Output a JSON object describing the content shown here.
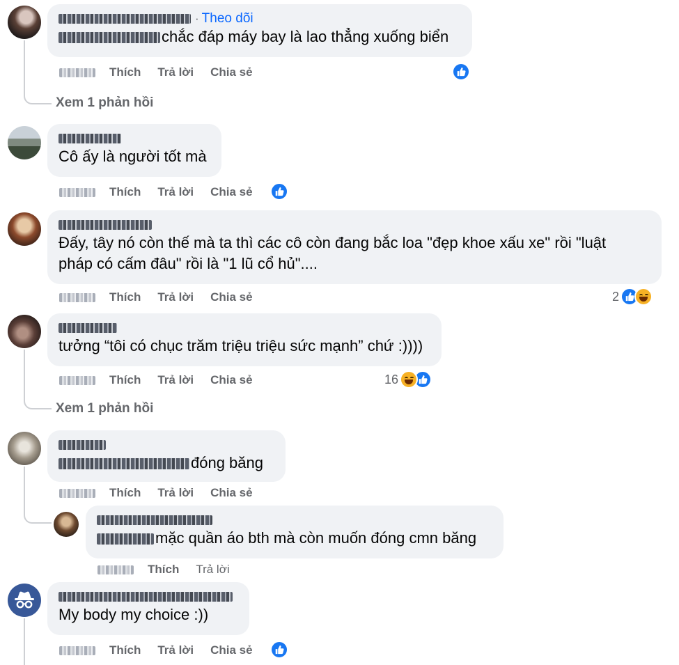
{
  "colors": {
    "bubble": "#f0f2f5",
    "link_blue": "#0866ff",
    "like_blue": "#1877f2",
    "muted": "#65676b"
  },
  "actions": {
    "like": "Thích",
    "reply": "Trả lời",
    "share": "Chia sẻ"
  },
  "comments": [
    {
      "follow_sep": "·",
      "follow": "Theo dõi",
      "text": "chắc đáp máy bay là lao thẳng xuống biển",
      "reactions": {
        "count": "",
        "icons": [
          "like-icon"
        ]
      },
      "view_replies": "Xem 1 phản hồi"
    },
    {
      "text": "Cô ấy là người tốt mà",
      "reactions": {
        "count": "",
        "icons": [
          "like-icon"
        ]
      }
    },
    {
      "text_line1": "Đấy, tây nó còn thế mà ta thì các cô còn đang bắc loa \"đẹp khoe xấu xe\" rồi \"luật",
      "text_line2": "pháp có cấm đâu\" rồi là \"1 lũ cổ hủ\"....",
      "reactions": {
        "count": "2",
        "icons": [
          "like-icon",
          "haha-icon"
        ]
      }
    },
    {
      "text": "tưởng “tôi có chục trăm triệu triệu sức mạnh” chứ :))))",
      "reactions": {
        "count": "16",
        "icons": [
          "haha-icon",
          "like-icon"
        ]
      },
      "view_replies": "Xem 1 phản hồi"
    },
    {
      "text": "đóng băng",
      "reply": {
        "text": "mặc quần áo bth mà còn muốn đóng cmn băng"
      }
    },
    {
      "text": "My body my choice :))",
      "reactions": {
        "count": "",
        "icons": [
          "like-icon"
        ]
      }
    }
  ]
}
